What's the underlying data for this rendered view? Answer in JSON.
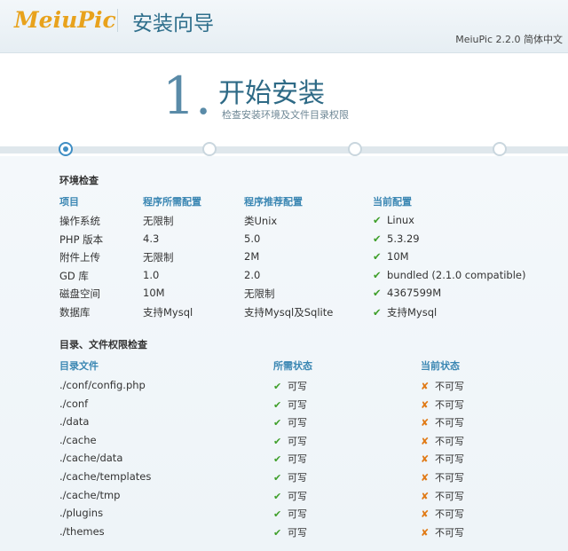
{
  "header": {
    "logo": "MeiuPic",
    "title": "安装向导",
    "version": "MeiuPic 2.2.0 简体中文"
  },
  "hero": {
    "step_number": "1.",
    "step_title": "开始安装",
    "step_desc": "检查安装环境及文件目录权限"
  },
  "progress": {
    "steps": 4,
    "current": 1,
    "fraction": 0.0
  },
  "env": {
    "title": "环境检查",
    "headers": [
      "项目",
      "程序所需配置",
      "程序推荐配置",
      "当前配置"
    ],
    "rows": [
      {
        "item": "操作系统",
        "required": "无限制",
        "recommended": "类Unix",
        "current": "Linux",
        "ok": true
      },
      {
        "item": "PHP 版本",
        "required": "4.3",
        "recommended": "5.0",
        "current": "5.3.29",
        "ok": true
      },
      {
        "item": "附件上传",
        "required": "无限制",
        "recommended": "2M",
        "current": "10M",
        "ok": true
      },
      {
        "item": "GD 库",
        "required": "1.0",
        "recommended": "2.0",
        "current": "bundled (2.1.0 compatible)",
        "ok": true
      },
      {
        "item": "磁盘空间",
        "required": "10M",
        "recommended": "无限制",
        "current": "4367599M",
        "ok": true
      },
      {
        "item": "数据库",
        "required": "支持Mysql",
        "recommended": "支持Mysql及Sqlite",
        "current": "支持Mysql",
        "ok": true
      }
    ]
  },
  "dirs": {
    "title": "目录、文件权限检查",
    "headers": [
      "目录文件",
      "所需状态",
      "当前状态"
    ],
    "required_label": "可写",
    "current_label": "不可写",
    "rows": [
      "./conf/config.php",
      "./conf",
      "./data",
      "./cache",
      "./cache/data",
      "./cache/templates",
      "./cache/tmp",
      "./plugins",
      "./themes"
    ]
  },
  "icons": {
    "check": "check-icon",
    "cross": "cross-icon"
  },
  "colors": {
    "accent": "#3f8ec4",
    "ok": "#3f9f2a",
    "fail": "#e07a16",
    "logo": "#e8a21c"
  }
}
